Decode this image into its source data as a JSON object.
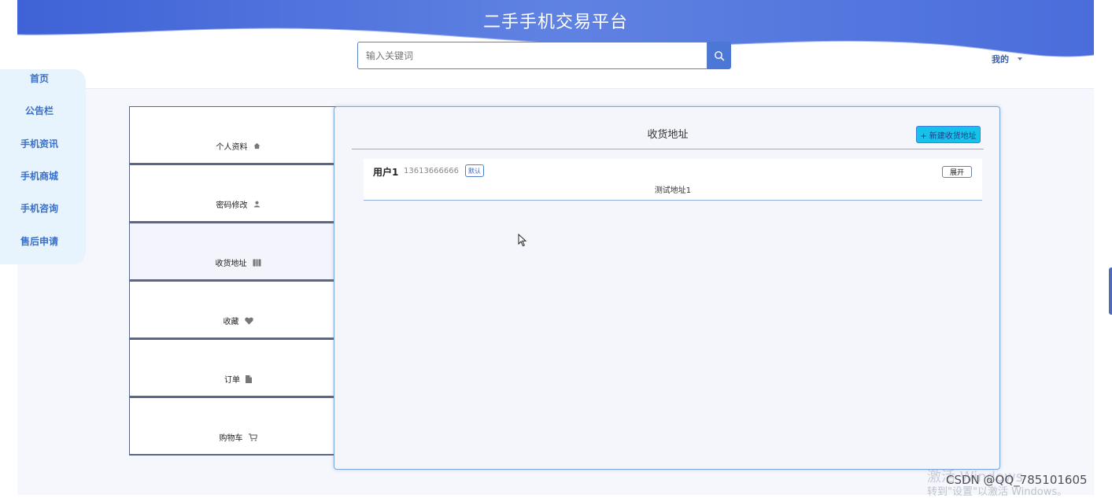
{
  "header": {
    "site_title": "二手手机交易平台",
    "search_placeholder": "输入关键词",
    "search_icon": "search-icon",
    "user_menu_label": "我的",
    "wave_color_start": "#3f62d6",
    "wave_color_end": "#6d8ee8"
  },
  "left_nav": {
    "items": [
      {
        "label": "首页"
      },
      {
        "label": "公告栏"
      },
      {
        "label": "手机资讯"
      },
      {
        "label": "手机商城"
      },
      {
        "label": "手机咨询"
      },
      {
        "label": "售后申请"
      }
    ]
  },
  "account_menu": {
    "items": [
      {
        "label": "个人资料",
        "icon": "home-icon"
      },
      {
        "label": "密码修改",
        "icon": "user-icon"
      },
      {
        "label": "收货地址",
        "icon": "map-icon",
        "active": true
      },
      {
        "label": "收藏",
        "icon": "heart-icon"
      },
      {
        "label": "订单",
        "icon": "file-icon"
      },
      {
        "label": "购物车",
        "icon": "cart-icon"
      }
    ]
  },
  "address_panel": {
    "title": "收货地址",
    "new_button": "+ 新建收货地址",
    "addresses": [
      {
        "name": "用户1",
        "phone": "13613666666",
        "badge": "默认",
        "expand": "展开",
        "detail": "测试地址1"
      }
    ]
  },
  "overlay": {
    "watermark_line1": "激活 Windows",
    "watermark_line2": "转到\"设置\"以激活 Windows。",
    "csdn_credit": "CSDN @QQ_785101605"
  },
  "colors": {
    "accent": "#4b77d6",
    "nav_text": "#3a6fc8",
    "new_button_bg": "#17c1ea"
  }
}
